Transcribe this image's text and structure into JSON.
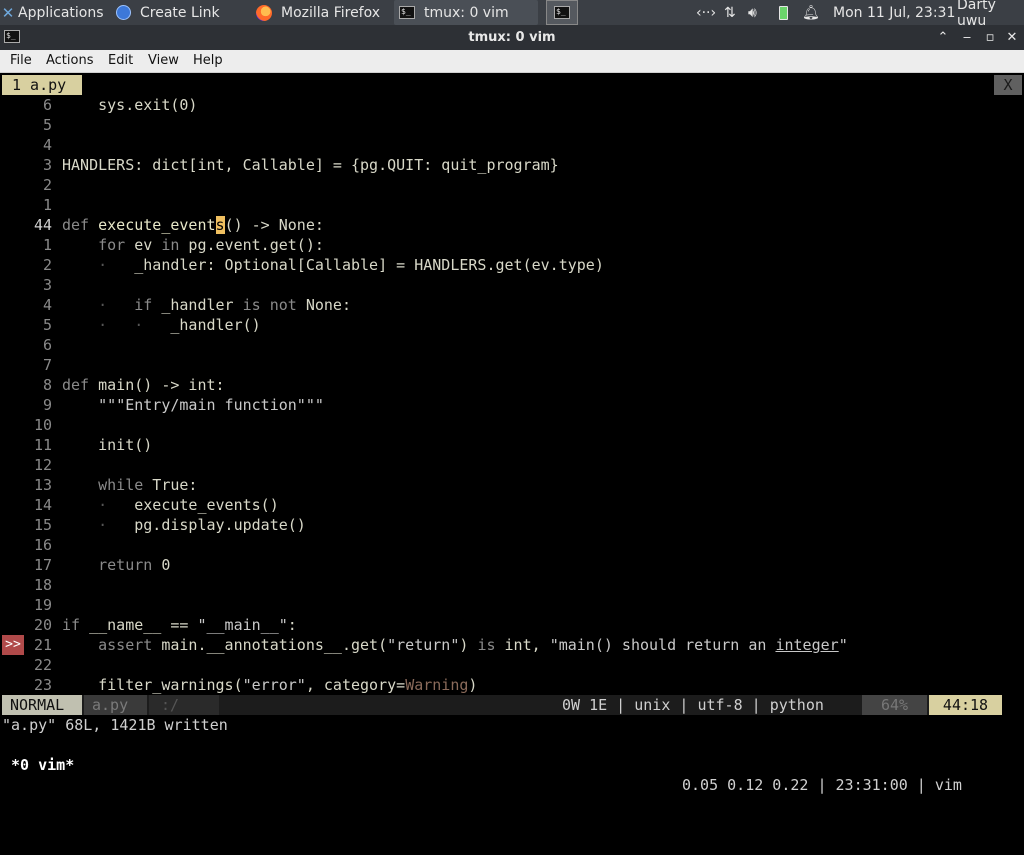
{
  "panel": {
    "applications": "Applications",
    "tasks": [
      "Create Link",
      "Mozilla Firefox",
      "tmux: 0 vim"
    ],
    "datetime": "Mon 11 Jul, 23:31",
    "user": "Darty uwu"
  },
  "window": {
    "title": "tmux: 0 vim"
  },
  "menu": {
    "items": [
      "File",
      "Actions",
      "Edit",
      "View",
      "Help"
    ]
  },
  "vim": {
    "tab_label": "1  a.py",
    "tab_close": "X",
    "lines": [
      {
        "n": "6",
        "text": "    sys.exit(0)"
      },
      {
        "n": "5",
        "text": ""
      },
      {
        "n": "4",
        "text": ""
      },
      {
        "n": "3",
        "text": "HANDLERS: dict[int, Callable] = {pg.QUIT: quit_program}"
      },
      {
        "n": "2",
        "text": ""
      },
      {
        "n": "1",
        "text": ""
      },
      {
        "n": "44",
        "text": "def execute_events() -> None:"
      },
      {
        "n": "1",
        "text": "    for ev in pg.event.get():"
      },
      {
        "n": "2",
        "text": "    ·   _handler: Optional[Callable] = HANDLERS.get(ev.type)"
      },
      {
        "n": "3",
        "text": ""
      },
      {
        "n": "4",
        "text": "    ·   if _handler is not None:"
      },
      {
        "n": "5",
        "text": "    ·   ·   _handler()"
      },
      {
        "n": "6",
        "text": ""
      },
      {
        "n": "7",
        "text": ""
      },
      {
        "n": "8",
        "text": "def main() -> int:"
      },
      {
        "n": "9",
        "text": "    \"\"\"Entry/main function\"\"\""
      },
      {
        "n": "10",
        "text": ""
      },
      {
        "n": "11",
        "text": "    init()"
      },
      {
        "n": "12",
        "text": ""
      },
      {
        "n": "13",
        "text": "    while True:"
      },
      {
        "n": "14",
        "text": "    ·   execute_events()"
      },
      {
        "n": "15",
        "text": "    ·   pg.display.update()"
      },
      {
        "n": "16",
        "text": ""
      },
      {
        "n": "17",
        "text": "    return 0"
      },
      {
        "n": "18",
        "text": ""
      },
      {
        "n": "19",
        "text": ""
      },
      {
        "n": "20",
        "text": "if __name__ == \"__main__\":"
      },
      {
        "n": "21",
        "text": "    assert main.__annotations__.get(\"return\") is int, \"main() should return an integer\""
      },
      {
        "n": "22",
        "text": ""
      },
      {
        "n": "23",
        "text": "    filter_warnings(\"error\", category=Warning)"
      }
    ],
    "sign_text": ">>",
    "status": {
      "mode": "NORMAL",
      "file": "a.py",
      "path": ":/",
      "info": "0W 1E | unix | utf-8 | python",
      "percent": "64%",
      "position": "44:18"
    },
    "cmdline": "\"a.py\" 68L, 1421B written"
  },
  "tmux": {
    "window": " *0 vim*",
    "right": "0.05 0.12 0.22 | 23:31:00 | vim"
  }
}
